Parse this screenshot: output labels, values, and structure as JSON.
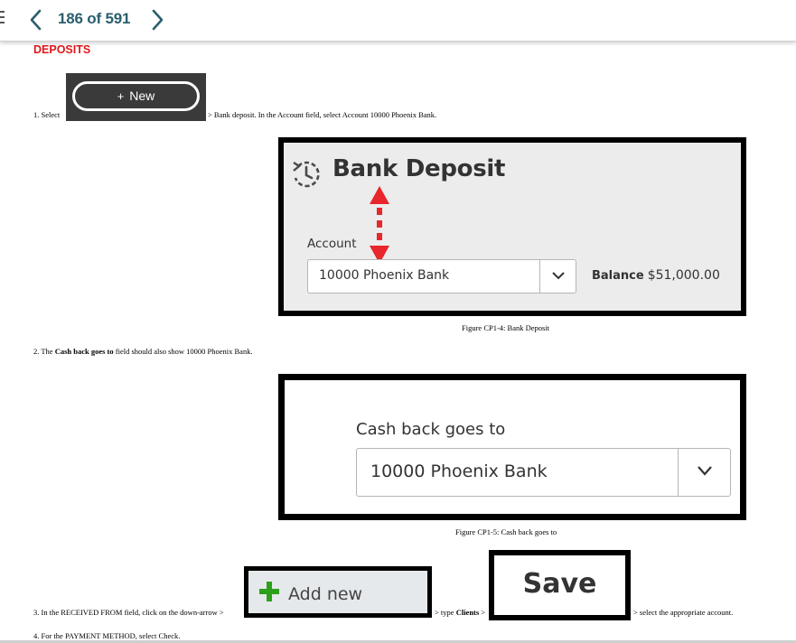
{
  "nav": {
    "page_indicator": "186 of 591",
    "prev_icon": "chevron-left-icon",
    "next_icon": "chevron-right-icon",
    "accent_color": "#2b5e6e"
  },
  "document": {
    "section_title": "DEPOSITS",
    "section_title_color": "#e0191b",
    "step1": {
      "prefix": "1. Select",
      "new_button_plus": "+",
      "new_button_label": "New",
      "suffix": "> Bank deposit. In the Account field, select Account 10000 Phoenix Bank."
    },
    "figure1": {
      "title": "Bank Deposit",
      "account_label": "Account",
      "account_value": "10000 Phoenix Bank",
      "balance_label": "Balance",
      "balance_value": "$51,000.00",
      "caption": "Figure CP1-4:  Bank Deposit"
    },
    "step2": {
      "prefix": "2. The",
      "bold": "Cash back goes to",
      "suffix": "field should also show 10000 Phoenix Bank."
    },
    "figure2": {
      "label": "Cash back goes to",
      "value": "10000 Phoenix Bank",
      "caption": "Figure CP1-5:  Cash back goes to"
    },
    "step3": {
      "prefix": "3. In the RECEIVED FROM field, click on the down-arrow >",
      "add_new_label": "Add new",
      "middle_prefix": "> type",
      "middle_bold": "Clients",
      "middle_suffix": ">",
      "save_label": "Save",
      "suffix": "> select the appropriate account.",
      "add_new_color": "#2ca01c"
    },
    "step4": {
      "text": "4. For the PAYMENT METHOD, select Check."
    }
  }
}
